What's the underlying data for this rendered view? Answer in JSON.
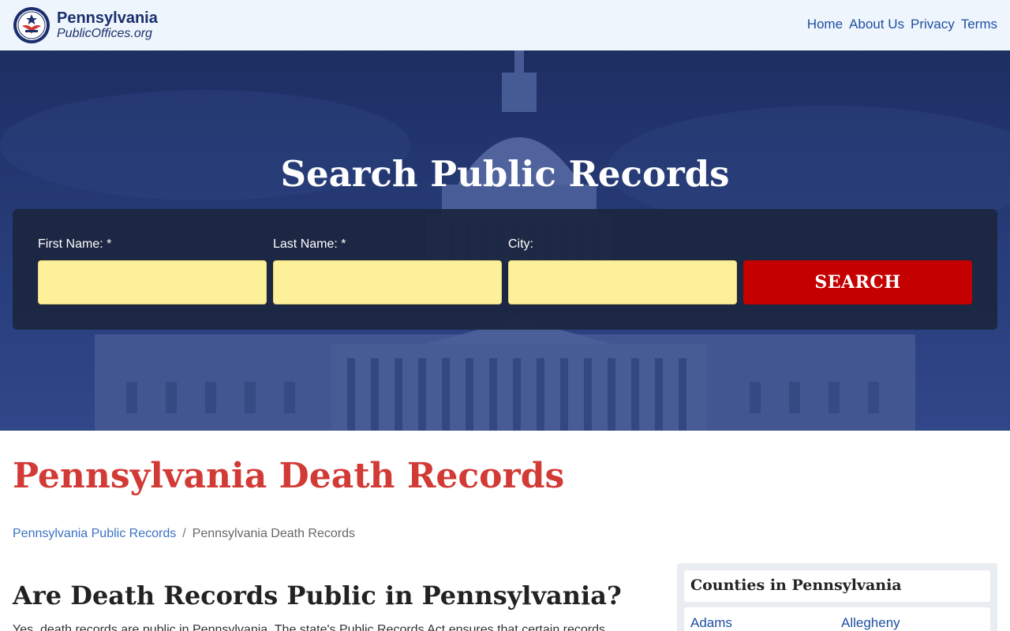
{
  "header": {
    "brand_name": "Pennsylvania",
    "brand_sub": "PublicOffices.org",
    "logo_text": "PUBLIC OFFICES",
    "nav": [
      {
        "label": "Home"
      },
      {
        "label": "About Us"
      },
      {
        "label": "Privacy"
      },
      {
        "label": "Terms"
      }
    ]
  },
  "hero": {
    "title": "Search Public Records",
    "form": {
      "first_name_label": "First Name:",
      "last_name_label": "Last Name:",
      "city_label": "City:",
      "required_mark": "*",
      "first_name_value": "",
      "last_name_value": "",
      "city_value": "",
      "search_button": "SEARCH"
    }
  },
  "main": {
    "page_title": "Pennsylvania Death Records",
    "breadcrumb": {
      "parent": "Pennsylvania Public Records",
      "separator": "/",
      "current": "Pennsylvania Death Records"
    },
    "section_title": "Are Death Records Public in Pennsylvania?",
    "paragraph_preview": "Yes, death records are public in Pennsylvania. The state's Public Records Act ensures that certain records..."
  },
  "sidebar": {
    "title": "Counties in Pennsylvania",
    "counties": [
      "Adams",
      "Allegheny"
    ]
  },
  "colors": {
    "header_bg": "#eef5fd",
    "brand_navy": "#1a2f6b",
    "nav_link": "#1f4fa0",
    "hero_overlay": "#24386f",
    "input_bg": "#fdf09b",
    "search_button_bg": "#c40000",
    "page_title": "#d23a35",
    "breadcrumb_link": "#3a72c4"
  }
}
